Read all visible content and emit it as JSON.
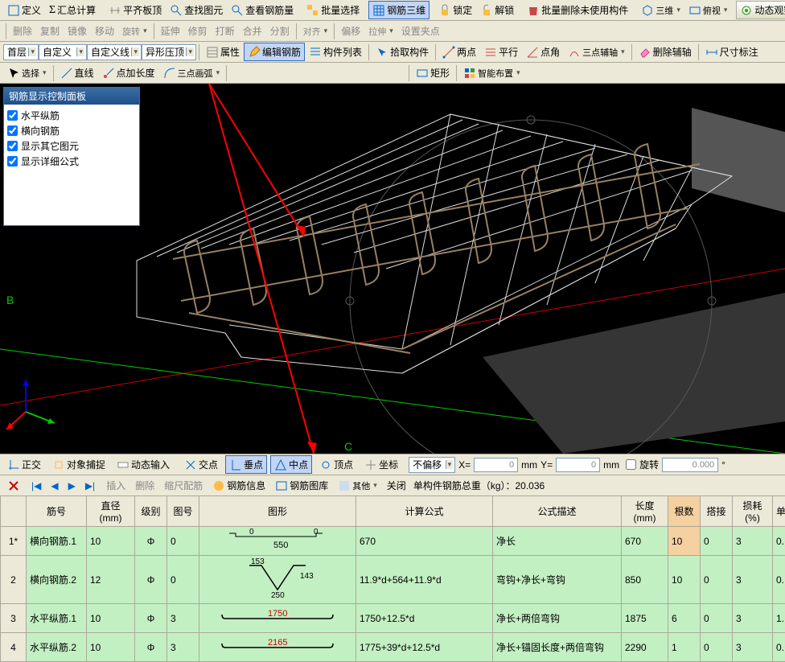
{
  "toolbar1": {
    "define": "定义",
    "sumCalc": "汇总计算",
    "flattenTop": "平齐板顶",
    "findElem": "查找图元",
    "viewRebar": "查看钢筋量",
    "batchSelect": "批量选择",
    "rebar3d": "钢筋三维",
    "lock": "锁定",
    "unlock": "解锁",
    "batchDelUnused": "批量删除未使用构件",
    "view3d": "三维",
    "perspective": "俯视",
    "dynObserve": "动态观察"
  },
  "toolbar2": {
    "delete": "删除",
    "copy": "复制",
    "mirror": "镜像",
    "move": "移动",
    "rotate": "旋转",
    "extend": "延伸",
    "trim": "修剪",
    "break": "打断",
    "merge": "合并",
    "split": "分割",
    "align": "对齐",
    "offset": "偏移",
    "stretch": "拉伸",
    "setGrip": "设置夹点"
  },
  "toolbar3": {
    "floor": "首层",
    "custom": "自定义",
    "customLine": "自定义线",
    "irregTop": "异形压顶",
    "attrs": "属性",
    "editRebar": "编辑钢筋",
    "elemList": "构件列表",
    "pickElem": "拾取构件",
    "twoPt": "两点",
    "parallel": "平行",
    "ptAngle": "点角",
    "threePtAux": "三点辅轴",
    "delAux": "删除辅轴",
    "dimLabel": "尺寸标注"
  },
  "toolbar4": {
    "select": "选择",
    "line": "直线",
    "ptAddLen": "点加长度",
    "threePtArc": "三点画弧",
    "rect": "矩形",
    "smartLayout": "智能布置"
  },
  "panel": {
    "title": "钢筋显示控制面板",
    "items": [
      "水平纵筋",
      "横向钢筋",
      "显示其它图元",
      "显示详细公式"
    ]
  },
  "statusbar": {
    "ortho": "正交",
    "osnap": "对象捕捉",
    "dynInput": "动态输入",
    "inter": "交点",
    "perp": "垂点",
    "mid": "中点",
    "vertex": "顶点",
    "coord": "坐标",
    "noOffset": "不偏移",
    "x": "X=",
    "y": "Y=",
    "mm": "mm",
    "rotate": "旋转",
    "val0": "0",
    "valAngle": "0.000",
    "deg": "°"
  },
  "subtoolbar": {
    "insert": "插入",
    "delete": "删除",
    "scaleRebar": "缩尺配筋",
    "rebarInfo": "钢筋信息",
    "rebarLib": "钢筋图库",
    "other": "其他",
    "close": "关闭",
    "totalWeight": "单构件钢筋总重（kg）：20.036"
  },
  "table": {
    "headers": [
      "",
      "筋号",
      "直径(mm)",
      "级别",
      "图号",
      "图形",
      "计算公式",
      "公式描述",
      "长度(mm)",
      "根数",
      "搭接",
      "损耗(%)",
      "单"
    ],
    "rows": [
      {
        "no": "1*",
        "name": "横向钢筋.1",
        "dia": "10",
        "lvl": "Φ",
        "fig": "0",
        "shapeText": "550",
        "formula": "670",
        "desc": "净长",
        "len": "670",
        "cnt": "10",
        "lap": "0",
        "loss": "3",
        "unit": "0."
      },
      {
        "no": "2",
        "name": "横向钢筋.2",
        "dia": "12",
        "lvl": "Φ",
        "fig": "0",
        "shapeTop": "153",
        "shapeMid": "143",
        "shapeBot": "250",
        "formula": "11.9*d+564+11.9*d",
        "desc": "弯钩+净长+弯钩",
        "len": "850",
        "cnt": "10",
        "lap": "0",
        "loss": "3",
        "unit": "0."
      },
      {
        "no": "3",
        "name": "水平纵筋.1",
        "dia": "10",
        "lvl": "Φ",
        "fig": "3",
        "shapeText": "1750",
        "formula": "1750+12.5*d",
        "desc": "净长+两倍弯钩",
        "len": "1875",
        "cnt": "6",
        "lap": "0",
        "loss": "3",
        "unit": "1."
      },
      {
        "no": "4",
        "name": "水平纵筋.2",
        "dia": "10",
        "lvl": "Φ",
        "fig": "3",
        "shapeText": "2165",
        "formula": "1775+39*d+12.5*d",
        "desc": "净长+锚固长度+两倍弯钩",
        "len": "2290",
        "cnt": "1",
        "lap": "0",
        "loss": "3",
        "unit": "0."
      }
    ]
  }
}
